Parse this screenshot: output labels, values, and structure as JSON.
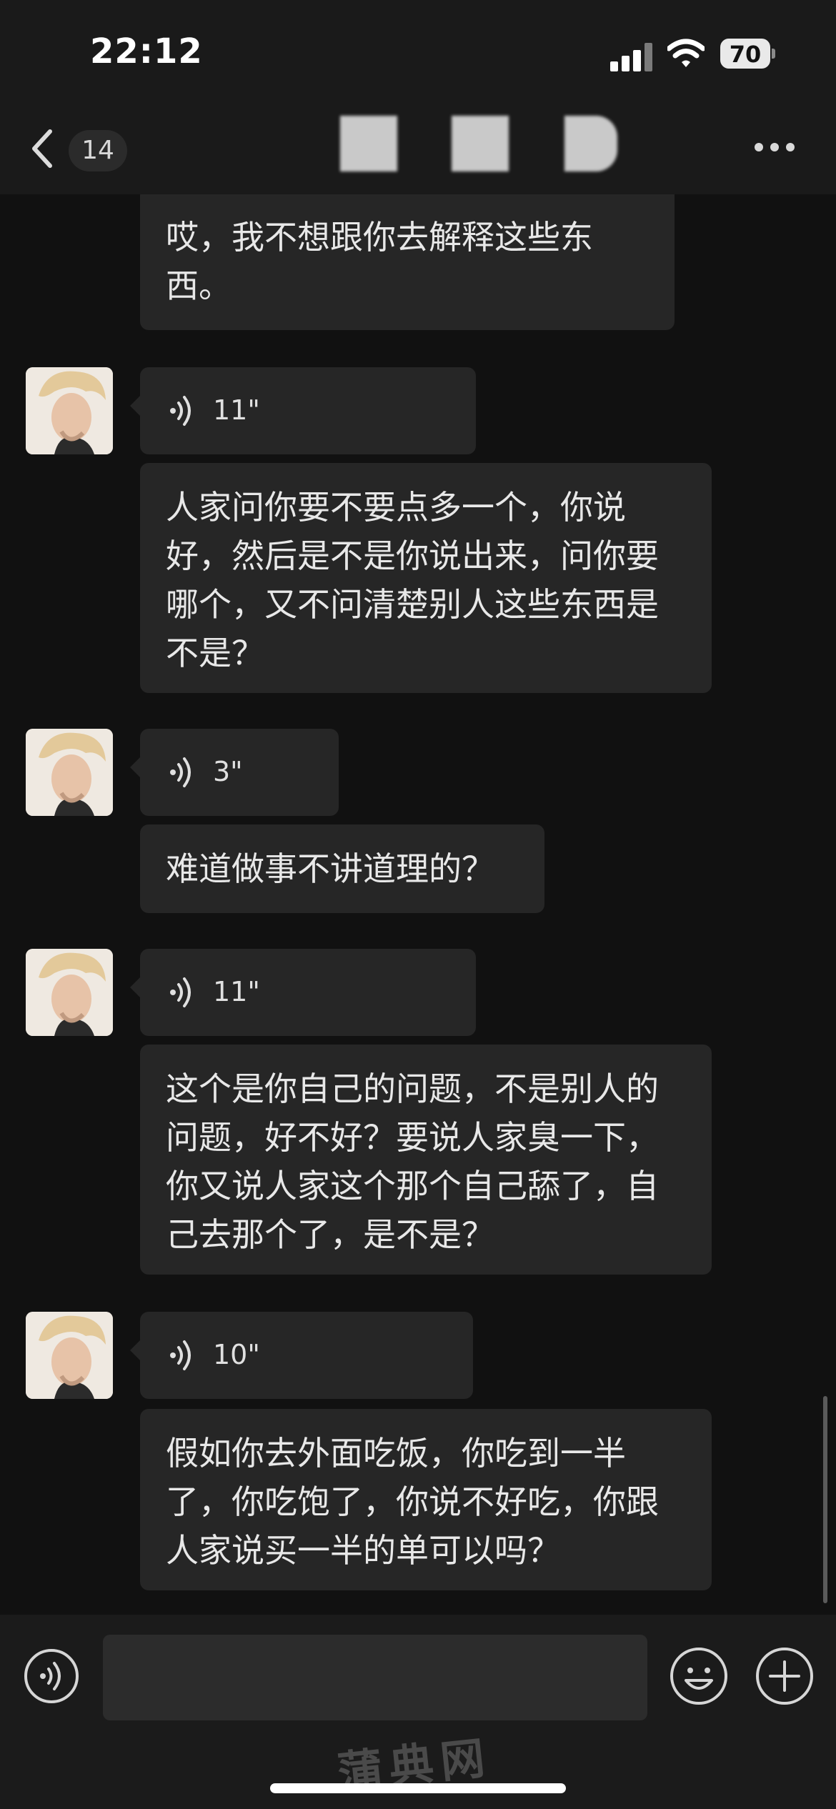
{
  "status": {
    "time": "22:12",
    "battery": "70"
  },
  "nav": {
    "unread_count": "14"
  },
  "messages": [
    {
      "type": "text",
      "text": "哎，我不想跟你去解释这些东西。"
    },
    {
      "type": "voice",
      "duration": "11\""
    },
    {
      "type": "text",
      "text": "人家问你要不要点多一个，你说好，然后是不是你说出来，问你要哪个，又不问清楚别人这些东西是不是？"
    },
    {
      "type": "voice",
      "duration": "3\""
    },
    {
      "type": "text",
      "text": "难道做事不讲道理的？"
    },
    {
      "type": "voice",
      "duration": "11\""
    },
    {
      "type": "text",
      "text": "这个是你自己的问题，不是别人的问题，好不好？要说人家臭一下，你又说人家这个那个自己舔了，自己去那个了，是不是？"
    },
    {
      "type": "voice",
      "duration": "10\""
    },
    {
      "type": "text",
      "text": "假如你去外面吃饭，你吃到一半了，你吃饱了，你说不好吃，你跟人家说买一半的单可以吗？"
    }
  ],
  "watermark": "蒲典网",
  "icons": [
    "back-chevron-icon",
    "more-dots-icon",
    "voice-wave-icon",
    "voice-input-icon",
    "emoji-icon",
    "plus-icon",
    "wifi-icon",
    "signal-icon",
    "battery-icon"
  ],
  "colors": {
    "background": "#111111",
    "bubble": "#262626",
    "bar": "#1a1a1a"
  }
}
